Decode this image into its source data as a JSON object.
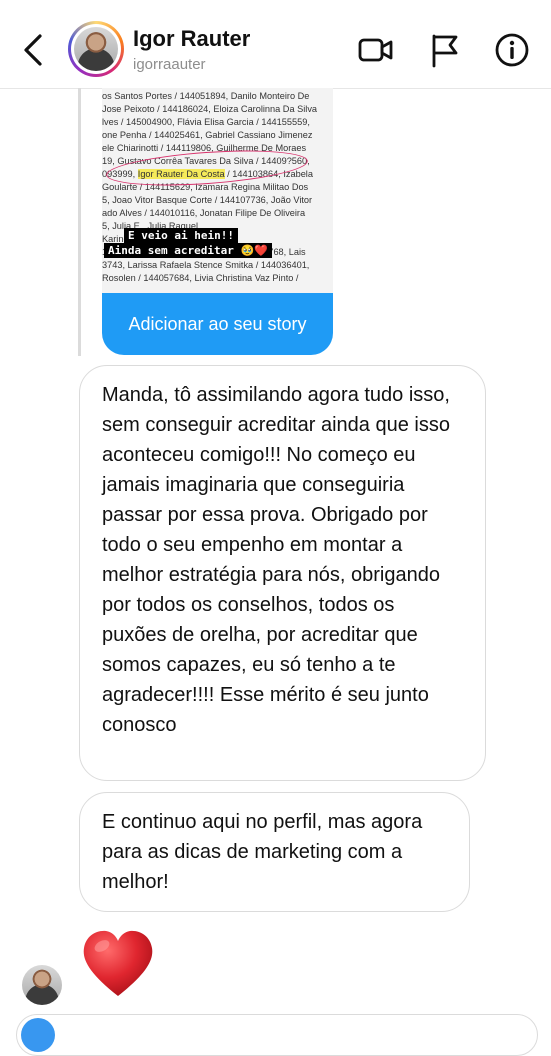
{
  "header": {
    "name": "Igor Rauter",
    "username": "igorraauter",
    "icons": [
      "back-chevron-icon",
      "video-call-icon",
      "flag-icon",
      "info-icon"
    ]
  },
  "shared_post": {
    "lines": [
      "os Santos Portes / 144051894, Danilo Monteiro De",
      "Jose Peixoto / 144186024, Eloiza Carolinna Da Silva",
      "lves / 145004900, Flávia Elisa Garcia / 144155559,",
      "one Penha / 144025461, Gabriel Cassiano Jimenez",
      "ele Chiarinotti / 144119806, Guilherme De Moraes",
      "19, Gustavo Corrêa Tavares Da Silva / 14409?560,",
      "093999, Igor Rauter Da Costa / 144103864, Izabela",
      "Goularte / 144115629, Izamara Regina Militao Dos",
      "5, Joao Vitor Basque Corte / 144107736, João Vitor",
      "ado Alves / 144010116, Jonatan Filipe De Oliveira",
      "5, Julia E                          , Julia Raquel",
      "                                           Karine",
      "113182548, Lais França Garcia / 145001768, Lais",
      "3743, Larissa Rafaela Stence Smitka / 144036401,",
      "Rosolen / 144057684, Livia Christina Vaz Pinto /"
    ],
    "highlighted_name": "Igor Rauter Da Costa",
    "sticker_line_1": "E veio ai hein!!",
    "sticker_line_2": "Ainda sem acreditar 🥹❤️",
    "add_to_story": "Adicionar ao seu story"
  },
  "messages": [
    {
      "text": "Manda, tô assimilando agora tudo isso, sem conseguir acreditar ainda que isso aconteceu comigo!!! No começo eu jamais imaginaria que conseguiria passar por essa prova. Obrigado por todo o seu empenho em montar a melhor estratégia para nós, obrigando por todos os conselhos, todos os puxões de orelha, por acreditar que somos capazes, eu só tenho a te agradecer!!!! Esse mérito é seu junto conosco"
    },
    {
      "text": "E continuo aqui no perfil, mas agora para as dicas de marketing com a melhor!"
    }
  ],
  "reaction": "heart-emoji",
  "colors": {
    "accent_blue": "#1f9bf5",
    "bubble_border": "#dbdbdb",
    "highlight_yellow": "#f5ea5a",
    "heart_red": "#e0262f"
  }
}
